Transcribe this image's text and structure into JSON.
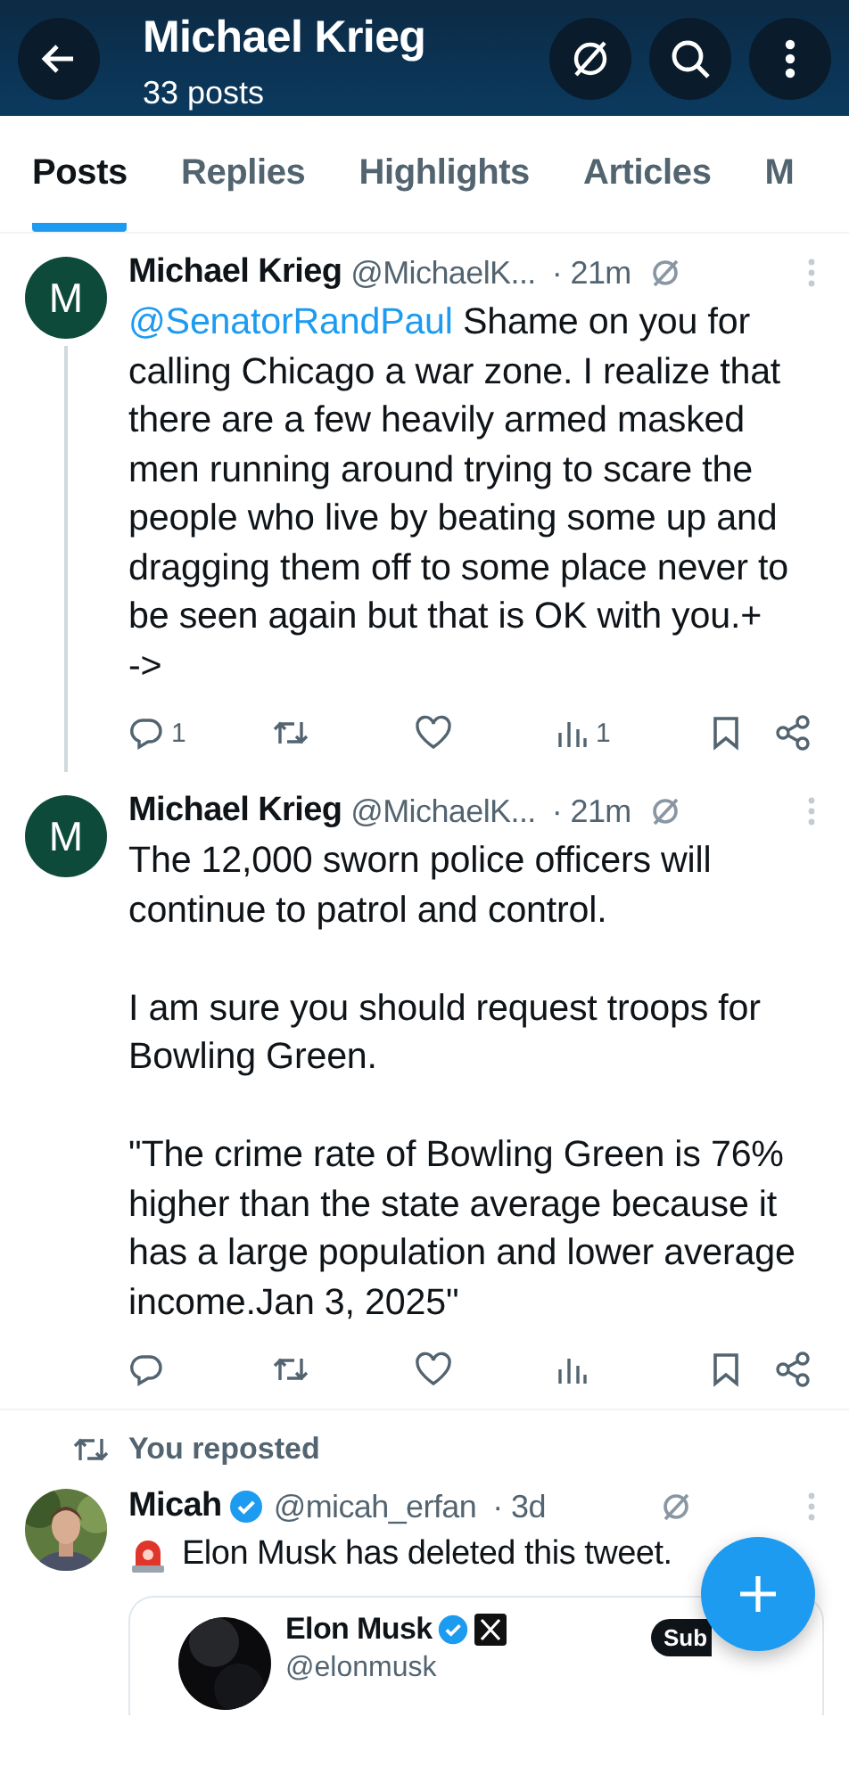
{
  "header": {
    "title": "Michael Krieg",
    "subtitle": "33 posts"
  },
  "tabs": [
    {
      "label": "Posts",
      "selected": true
    },
    {
      "label": "Replies",
      "selected": false
    },
    {
      "label": "Highlights",
      "selected": false
    },
    {
      "label": "Articles",
      "selected": false
    },
    {
      "label": "M",
      "selected": false
    }
  ],
  "posts": [
    {
      "avatar_letter": "M",
      "name": "Michael Krieg",
      "handle": "@MichaelK...",
      "time": "· 21m",
      "thread_line": true,
      "mention": "@SenatorRandPaul",
      "text": " Shame on you for calling Chicago a war zone. I realize that there are a few heavily armed masked men running around trying to scare the people who live by beating some up and dragging them off to some place never to be seen again but that is OK with you.+\n->",
      "replies": "1",
      "views": "1"
    },
    {
      "avatar_letter": "M",
      "name": "Michael Krieg",
      "handle": "@MichaelK...",
      "time": "· 21m",
      "thread_line": false,
      "text": "The 12,000 sworn police officers will continue to patrol and control.\n\nI am sure you should request troops for Bowling Green.\n\n\"The crime rate of Bowling Green is 76% higher than the state average because it has a large population and lower average income.Jan 3, 2025\""
    }
  ],
  "repost": {
    "label": "You reposted",
    "name": "Micah",
    "verified": true,
    "handle": "@micah_erfan",
    "time": "· 3d",
    "text": "Elon Musk has deleted this tweet.",
    "quote": {
      "name": "Elon Musk",
      "verified": true,
      "handle": "@elonmusk",
      "button": "Sub"
    }
  }
}
